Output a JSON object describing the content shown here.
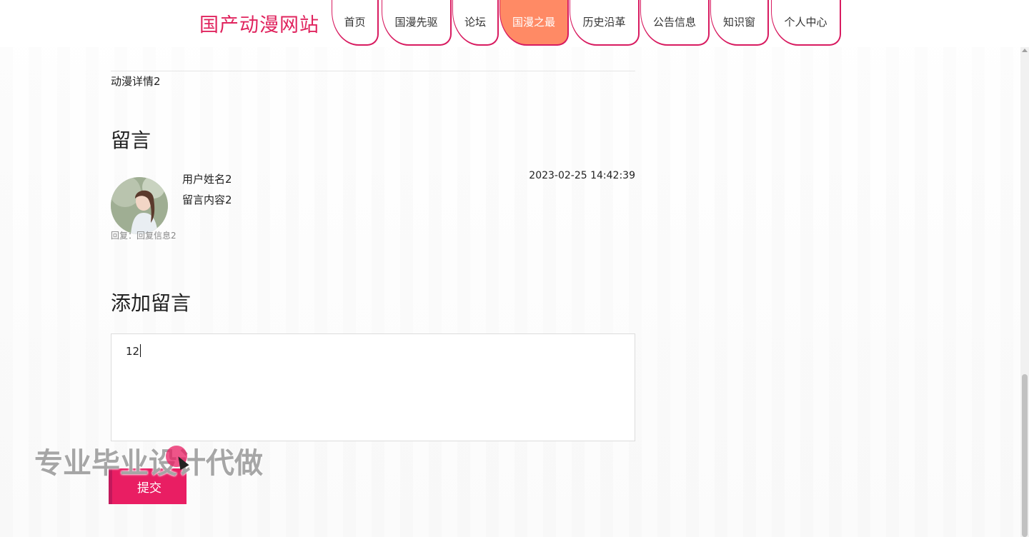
{
  "header": {
    "site_title": "国产动漫网站",
    "nav": [
      {
        "label": "首页"
      },
      {
        "label": "国漫先驱"
      },
      {
        "label": "论坛"
      },
      {
        "label": "国漫之最",
        "active": true
      },
      {
        "label": "历史沿革"
      },
      {
        "label": "公告信息"
      },
      {
        "label": "知识窗"
      },
      {
        "label": "个人中心"
      }
    ],
    "accent_color": "#e0245e",
    "active_tab_color": "#ff8a65"
  },
  "detail": {
    "text": "动漫详情2"
  },
  "messages": {
    "title": "留言",
    "items": [
      {
        "username": "用户姓名2",
        "content": "留言内容2",
        "time": "2023-02-25 14:42:39",
        "reply": "回复：回复信息2",
        "avatar_icon": "avatar-photo"
      }
    ]
  },
  "add_message": {
    "title": "添加留言",
    "textarea_value": "12",
    "submit_label": "提交"
  },
  "overlay": {
    "watermark": "专业毕业设计代做"
  }
}
